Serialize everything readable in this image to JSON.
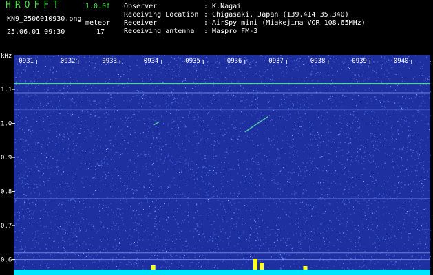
{
  "header": {
    "brand": "HROFFT",
    "version": "1.0.0f",
    "filename": "KN9_2506010930.png",
    "datetime": "25.06.01 09:30",
    "meteor_label": "meteor",
    "meteor_count": "17",
    "info": [
      {
        "label": "Observer",
        "value": ": K.Nagai"
      },
      {
        "label": "Receiving Location",
        "value": ": Chigasaki, Japan (139.414 35.340)"
      },
      {
        "label": "Receiver",
        "value": ": AirSpy mini (Miakejima VOR 108.65MHz)"
      },
      {
        "label": "Receiving antenna",
        "value": ": Maspro FM-3"
      }
    ]
  },
  "colors": {
    "background": "#1e2fa0",
    "noise_light": "#4f6ef0",
    "signal": "#58e0a8",
    "text_green": "#3fe03f",
    "baseline": "#00e5ff",
    "burst": "#ffff20"
  },
  "chart_data": {
    "type": "heatmap",
    "ylabel": "kHz",
    "yticks": [
      0.6,
      0.7,
      0.8,
      0.9,
      1.0,
      1.1
    ],
    "ylim": [
      0.575,
      1.185
    ],
    "time_labels": [
      "0931",
      "0932",
      "0933",
      "0934",
      "0935",
      "0936",
      "0937",
      "0938",
      "0939",
      "0940"
    ],
    "xlim": [
      0,
      10
    ],
    "carrier_lines": [
      {
        "freq": 1.118,
        "strength": "strong"
      },
      {
        "freq": 1.09,
        "strength": "medium"
      },
      {
        "freq": 1.04,
        "strength": "faint"
      },
      {
        "freq": 0.78,
        "strength": "faint"
      },
      {
        "freq": 0.62,
        "strength": "medium"
      },
      {
        "freq": 0.6,
        "strength": "medium"
      }
    ],
    "meteor_echoes": [
      {
        "x_start": 5.55,
        "f_start": 0.975,
        "x_end": 6.1,
        "f_end": 1.02
      },
      {
        "x_start": 3.35,
        "f_start": 0.995,
        "x_end": 3.5,
        "f_end": 1.005
      }
    ],
    "baseline_bursts": [
      {
        "x": 5.8,
        "height": 16
      },
      {
        "x": 5.95,
        "height": 10
      },
      {
        "x": 3.35,
        "height": 6
      },
      {
        "x": 7.0,
        "height": 5
      }
    ]
  }
}
